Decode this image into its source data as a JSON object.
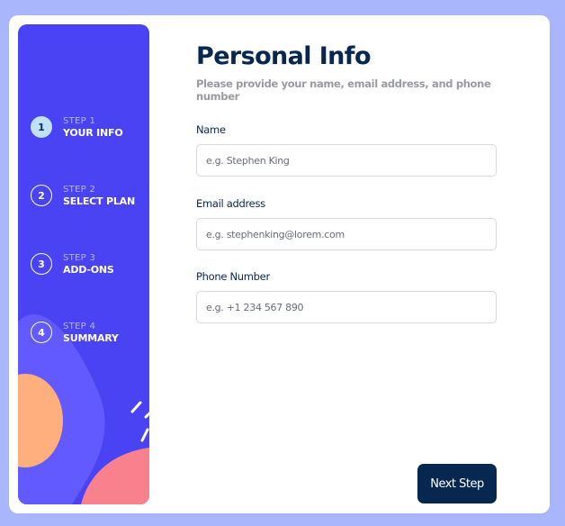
{
  "steps": [
    {
      "number": "1",
      "label": "STEP 1",
      "title": "YOUR INFO",
      "active": true
    },
    {
      "number": "2",
      "label": "STEP 2",
      "title": "SELECT PLAN",
      "active": false
    },
    {
      "number": "3",
      "label": "STEP 3",
      "title": "ADD-ONS",
      "active": false
    },
    {
      "number": "4",
      "label": "STEP 4",
      "title": "SUMMARY",
      "active": false
    }
  ],
  "main": {
    "title": "Personal Info",
    "subtitle": "Please provide your name, email address, and phone number"
  },
  "form": {
    "name": {
      "label": "Name",
      "placeholder": "e.g. Stephen King",
      "value": ""
    },
    "email": {
      "label": "Email address",
      "placeholder": "e.g. stephenking@lorem.com",
      "value": ""
    },
    "phone": {
      "label": "Phone Number",
      "placeholder": "e.g. +1 234 567 890",
      "value": ""
    }
  },
  "actions": {
    "next_label": "Next Step"
  },
  "colors": {
    "background": "#a9b6fb",
    "sidebar": "#4a43f3",
    "active_step": "#bee2fd",
    "primary_dark": "#062750",
    "deco_orange": "#ffaf7e",
    "deco_pink": "#f9818e",
    "deco_purple": "#6259ff"
  }
}
